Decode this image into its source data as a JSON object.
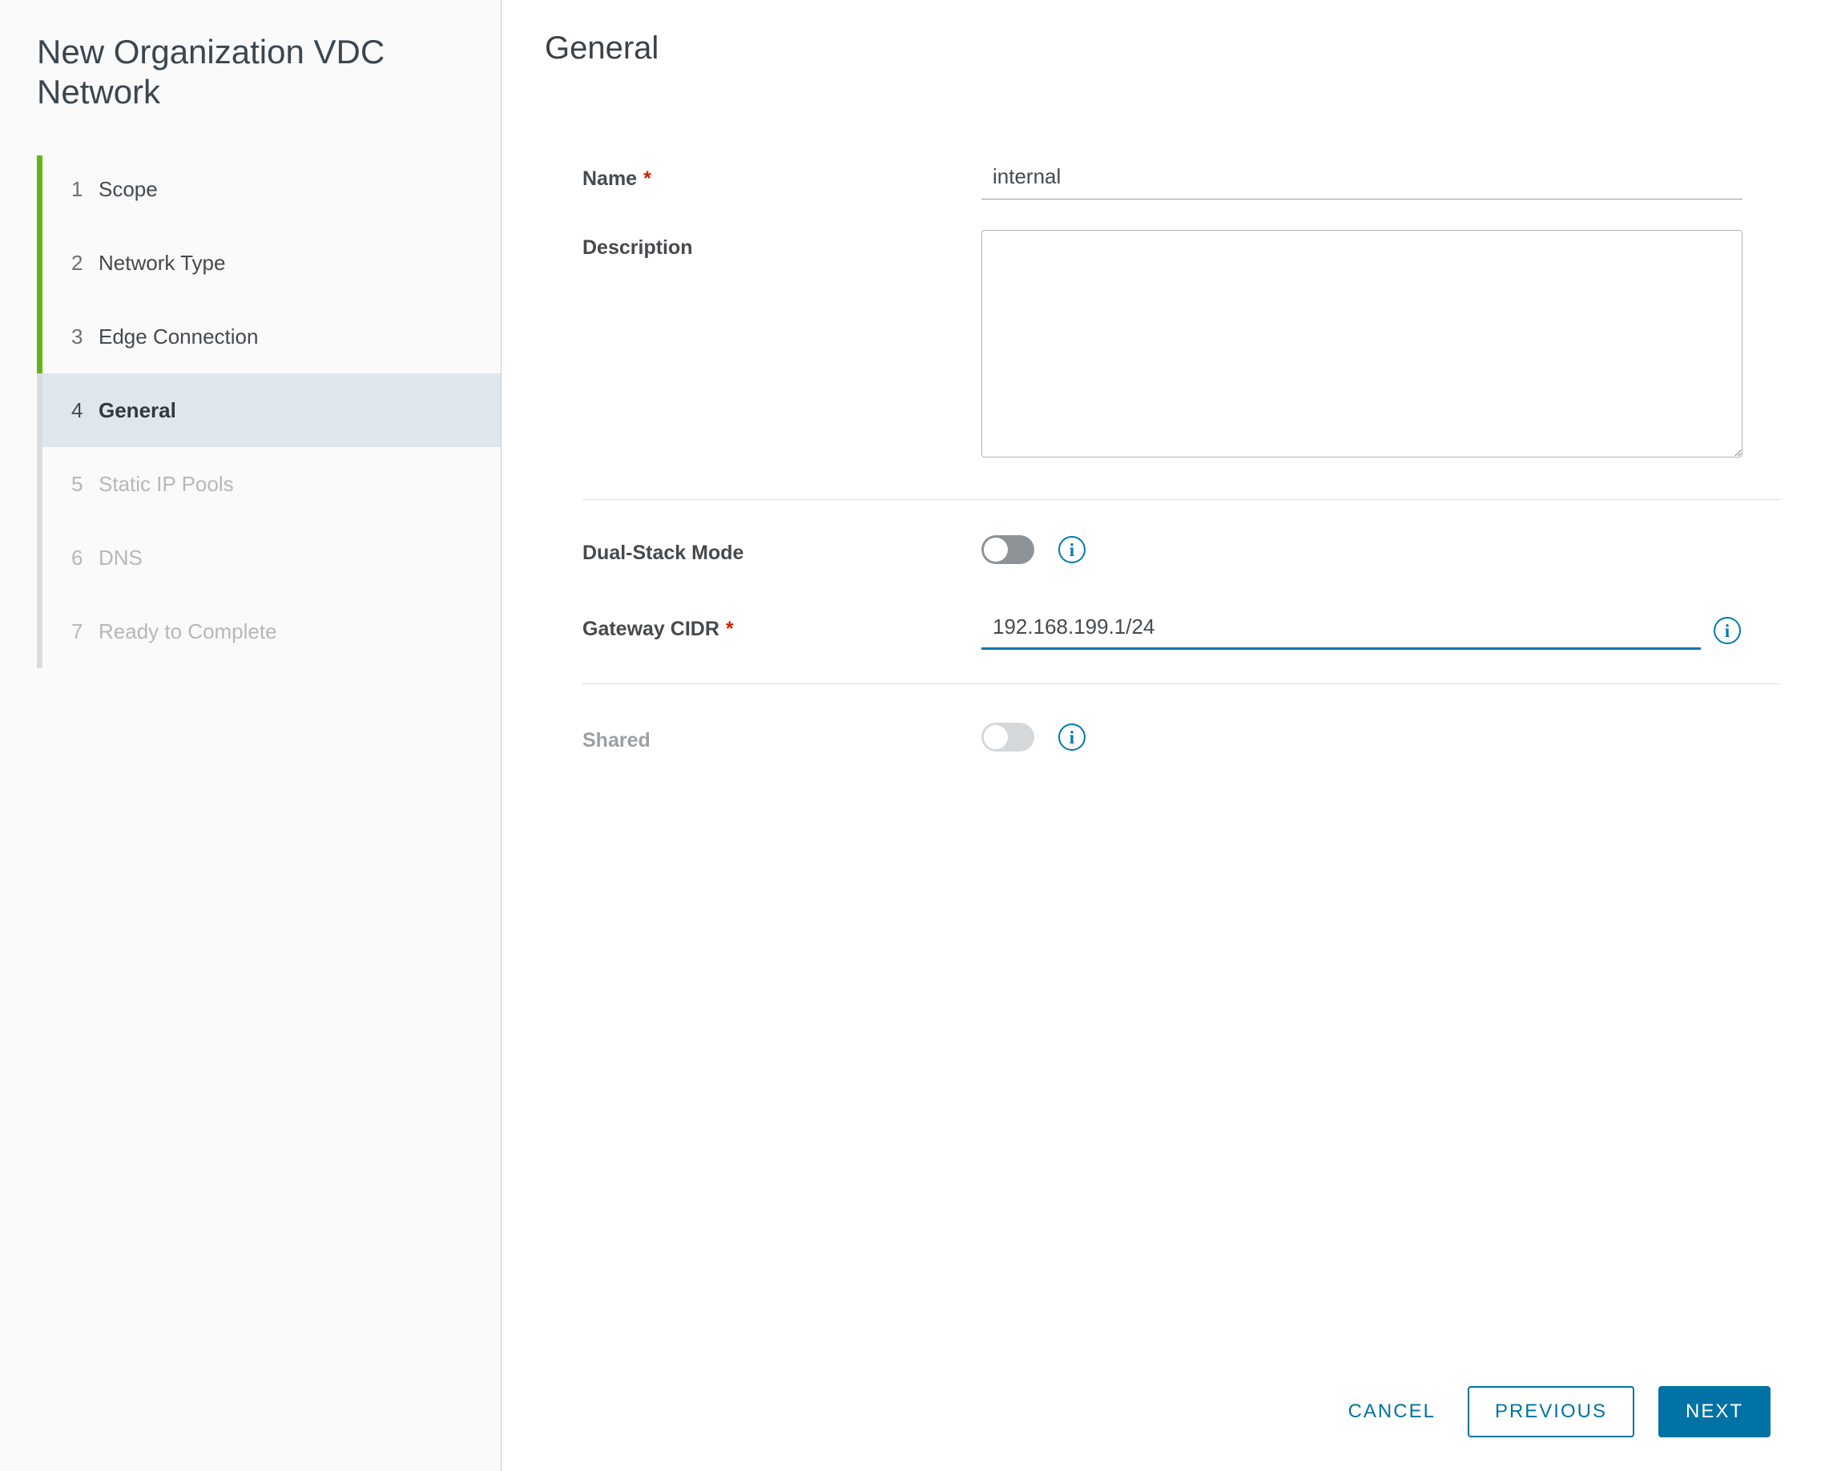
{
  "sidebar": {
    "title": "New Organization VDC Network",
    "steps": [
      {
        "num": "1",
        "label": "Scope"
      },
      {
        "num": "2",
        "label": "Network Type"
      },
      {
        "num": "3",
        "label": "Edge Connection"
      },
      {
        "num": "4",
        "label": "General"
      },
      {
        "num": "5",
        "label": "Static IP Pools"
      },
      {
        "num": "6",
        "label": "DNS"
      },
      {
        "num": "7",
        "label": "Ready to Complete"
      }
    ]
  },
  "content": {
    "heading": "General",
    "fields": {
      "name": {
        "label": "Name",
        "required_marker": "*",
        "value": "internal"
      },
      "description": {
        "label": "Description",
        "value": ""
      },
      "dual_stack_mode": {
        "label": "Dual-Stack Mode",
        "state": "off"
      },
      "gateway_cidr": {
        "label": "Gateway CIDR",
        "required_marker": "*",
        "value": "192.168.199.1/24"
      },
      "shared": {
        "label": "Shared",
        "state": "off"
      }
    }
  },
  "footer": {
    "cancel_label": "CANCEL",
    "previous_label": "PREVIOUS",
    "next_label": "NEXT"
  },
  "colors": {
    "primary": "#0072a3",
    "info_icon": "#0079ad",
    "step_progress_green": "#61b715",
    "active_step_bg": "#dee7ee",
    "required_red": "#c92100"
  }
}
